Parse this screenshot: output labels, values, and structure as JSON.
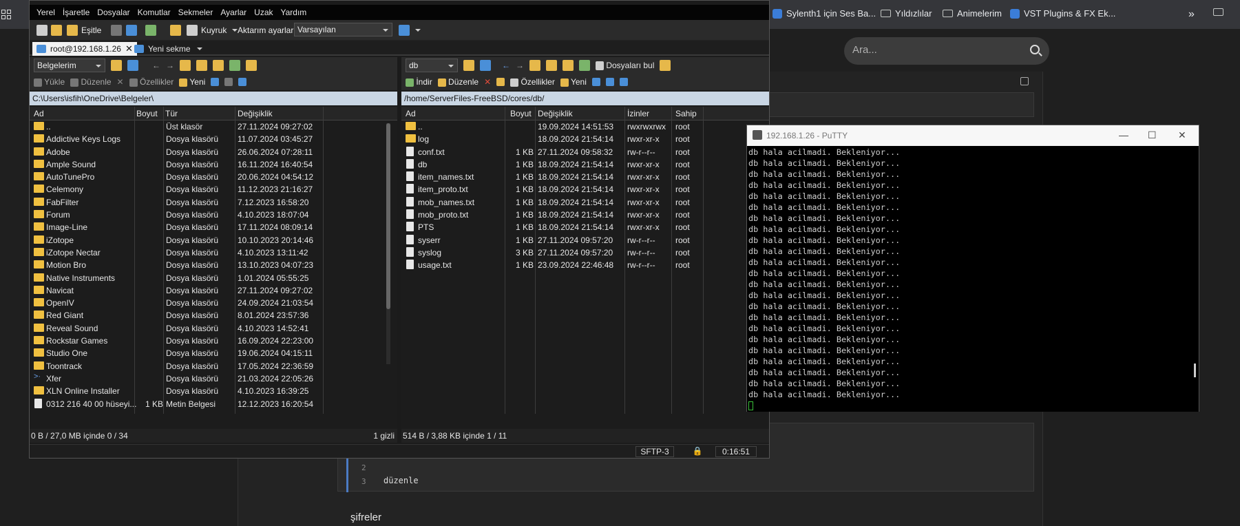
{
  "browser": {
    "bookmarks": [
      {
        "label": "Sylenth1 için Ses Ba...",
        "icon": "plugin-icon"
      },
      {
        "label": "Yıldızlılar",
        "icon": "folder-icon"
      },
      {
        "label": "Animelerim",
        "icon": "folder-icon"
      },
      {
        "label": "VST Plugins & FX Ek...",
        "icon": "plugin-icon"
      }
    ],
    "more": "»",
    "search_placeholder": "Ara...",
    "code_lines": [
      "2",
      "3"
    ],
    "code_text": "düzenle",
    "heading": "şifreler"
  },
  "winscp": {
    "menu": [
      "Yerel",
      "İşaretle",
      "Dosyalar",
      "Komutlar",
      "Sekmeler",
      "Ayarlar",
      "Uzak",
      "Yardım"
    ],
    "toolbar": {
      "sync": "Eşitle",
      "queue": "Kuyruk",
      "transfer_label": "Aktarım ayarları",
      "transfer_value": "Varsayılan"
    },
    "tabs": {
      "session": "root@192.168.1.26",
      "new_tab": "Yeni sekme"
    },
    "left": {
      "location": "Belgelerim",
      "actions": {
        "upload": "Yükle",
        "edit": "Düzenle",
        "props": "Özellikler",
        "new": "Yeni"
      },
      "path": "C:\\Users\\isfih\\OneDrive\\Belgeler\\",
      "columns": [
        "Ad",
        "Boyut",
        "Tür",
        "Değişiklik"
      ],
      "rows": [
        {
          "name": "..",
          "size": "",
          "type": "Üst klasör",
          "date": "27.11.2024 09:27:02",
          "icon": "up"
        },
        {
          "name": "Addictive Keys Logs",
          "size": "",
          "type": "Dosya klasörü",
          "date": "11.07.2024 03:45:27",
          "icon": "folder"
        },
        {
          "name": "Adobe",
          "size": "",
          "type": "Dosya klasörü",
          "date": "26.06.2024 07:28:11",
          "icon": "folder"
        },
        {
          "name": "Ample Sound",
          "size": "",
          "type": "Dosya klasörü",
          "date": "16.11.2024 16:40:54",
          "icon": "folder"
        },
        {
          "name": "AutoTunePro",
          "size": "",
          "type": "Dosya klasörü",
          "date": "20.06.2024 04:54:12",
          "icon": "folder"
        },
        {
          "name": "Celemony",
          "size": "",
          "type": "Dosya klasörü",
          "date": "11.12.2023 21:16:27",
          "icon": "folder"
        },
        {
          "name": "FabFilter",
          "size": "",
          "type": "Dosya klasörü",
          "date": "7.12.2023 16:58:20",
          "icon": "folder"
        },
        {
          "name": "Forum",
          "size": "",
          "type": "Dosya klasörü",
          "date": "4.10.2023 18:07:04",
          "icon": "folder"
        },
        {
          "name": "Image-Line",
          "size": "",
          "type": "Dosya klasörü",
          "date": "17.11.2024 08:09:14",
          "icon": "folder"
        },
        {
          "name": "iZotope",
          "size": "",
          "type": "Dosya klasörü",
          "date": "10.10.2023 20:14:46",
          "icon": "folder"
        },
        {
          "name": "iZotope Nectar",
          "size": "",
          "type": "Dosya klasörü",
          "date": "4.10.2023 13:11:42",
          "icon": "folder"
        },
        {
          "name": "Motion Bro",
          "size": "",
          "type": "Dosya klasörü",
          "date": "13.10.2023 04:07:23",
          "icon": "folder"
        },
        {
          "name": "Native Instruments",
          "size": "",
          "type": "Dosya klasörü",
          "date": "1.01.2024 05:55:25",
          "icon": "folder"
        },
        {
          "name": "Navicat",
          "size": "",
          "type": "Dosya klasörü",
          "date": "27.11.2024 09:27:02",
          "icon": "folder"
        },
        {
          "name": "OpenIV",
          "size": "",
          "type": "Dosya klasörü",
          "date": "24.09.2024 21:03:54",
          "icon": "folder"
        },
        {
          "name": "Red Giant",
          "size": "",
          "type": "Dosya klasörü",
          "date": "8.01.2024 23:57:36",
          "icon": "folder"
        },
        {
          "name": "Reveal Sound",
          "size": "",
          "type": "Dosya klasörü",
          "date": "4.10.2023 14:52:41",
          "icon": "folder"
        },
        {
          "name": "Rockstar Games",
          "size": "",
          "type": "Dosya klasörü",
          "date": "16.09.2024 22:23:00",
          "icon": "folder"
        },
        {
          "name": "Studio One",
          "size": "",
          "type": "Dosya klasörü",
          "date": "19.06.2024 04:15:11",
          "icon": "folder"
        },
        {
          "name": "Toontrack",
          "size": "",
          "type": "Dosya klasörü",
          "date": "17.05.2024 22:36:59",
          "icon": "folder"
        },
        {
          "name": "Xfer",
          "size": "",
          "type": "Dosya klasörü",
          "date": "21.03.2024 22:05:26",
          "icon": "xfer"
        },
        {
          "name": "XLN Online Installer",
          "size": "",
          "type": "Dosya klasörü",
          "date": "4.10.2023 16:39:25",
          "icon": "folder"
        },
        {
          "name": "0312 216 40 00 hüseyi...",
          "size": "1 KB",
          "type": "Metin Belgesi",
          "date": "12.12.2023 16:20:54",
          "icon": "file"
        }
      ],
      "status": "0 B / 27,0 MB içinde 0 / 34",
      "hidden": "1 gizli"
    },
    "right": {
      "location": "db",
      "actions": {
        "download": "İndir",
        "edit": "Düzenle",
        "props": "Özellikler",
        "new": "Yeni",
        "find": "Dosyaları bul"
      },
      "path": "/home/ServerFiles-FreeBSD/cores/db/",
      "columns": [
        "Ad",
        "Boyut",
        "Değişiklik",
        "İzinler",
        "Sahip"
      ],
      "rows": [
        {
          "name": "..",
          "size": "",
          "date": "19.09.2024 14:51:53",
          "perm": "rwxrwxrwx",
          "owner": "root",
          "icon": "up"
        },
        {
          "name": "log",
          "size": "",
          "date": "18.09.2024 21:54:14",
          "perm": "rwxr-xr-x",
          "owner": "root",
          "icon": "folder"
        },
        {
          "name": "conf.txt",
          "size": "1 KB",
          "date": "27.11.2024 09:58:32",
          "perm": "rw-r--r--",
          "owner": "root",
          "icon": "file"
        },
        {
          "name": "db",
          "size": "1 KB",
          "date": "18.09.2024 21:54:14",
          "perm": "rwxr-xr-x",
          "owner": "root",
          "icon": "file"
        },
        {
          "name": "item_names.txt",
          "size": "1 KB",
          "date": "18.09.2024 21:54:14",
          "perm": "rwxr-xr-x",
          "owner": "root",
          "icon": "file"
        },
        {
          "name": "item_proto.txt",
          "size": "1 KB",
          "date": "18.09.2024 21:54:14",
          "perm": "rwxr-xr-x",
          "owner": "root",
          "icon": "file"
        },
        {
          "name": "mob_names.txt",
          "size": "1 KB",
          "date": "18.09.2024 21:54:14",
          "perm": "rwxr-xr-x",
          "owner": "root",
          "icon": "file"
        },
        {
          "name": "mob_proto.txt",
          "size": "1 KB",
          "date": "18.09.2024 21:54:14",
          "perm": "rwxr-xr-x",
          "owner": "root",
          "icon": "file"
        },
        {
          "name": "PTS",
          "size": "1 KB",
          "date": "18.09.2024 21:54:14",
          "perm": "rwxr-xr-x",
          "owner": "root",
          "icon": "file"
        },
        {
          "name": "syserr",
          "size": "1 KB",
          "date": "27.11.2024 09:57:20",
          "perm": "rw-r--r--",
          "owner": "root",
          "icon": "file"
        },
        {
          "name": "syslog",
          "size": "3 KB",
          "date": "27.11.2024 09:57:20",
          "perm": "rw-r--r--",
          "owner": "root",
          "icon": "file"
        },
        {
          "name": "usage.txt",
          "size": "1 KB",
          "date": "23.09.2024 22:46:48",
          "perm": "rw-r--r--",
          "owner": "root",
          "icon": "file"
        }
      ],
      "status": "514 B / 3,88 KB içinde 1 / 11"
    },
    "statusbar": {
      "protocol": "SFTP-3",
      "elapsed": "0:16:51"
    }
  },
  "putty": {
    "title": "192.168.1.26 - PuTTY",
    "line": "db hala acilmadi. Bekleniyor...",
    "line_count": 23
  }
}
